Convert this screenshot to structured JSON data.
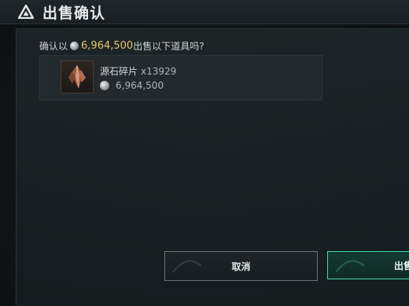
{
  "header": {
    "title": "出售确认",
    "icon": "triangle-logo-icon"
  },
  "dialog": {
    "confirm_prefix": "确认以",
    "confirm_amount": "6,964,500",
    "confirm_suffix": "出售以下道具吗?",
    "item": {
      "name": "源石碎片",
      "quantity": "x13929",
      "price": "6,964,500",
      "icon": "crystal-shard-icon"
    }
  },
  "buttons": {
    "cancel_label": "取消",
    "sell_label": "出售"
  },
  "colors": {
    "amount": "#e8c66a",
    "sell_border": "#3fd9a6"
  }
}
